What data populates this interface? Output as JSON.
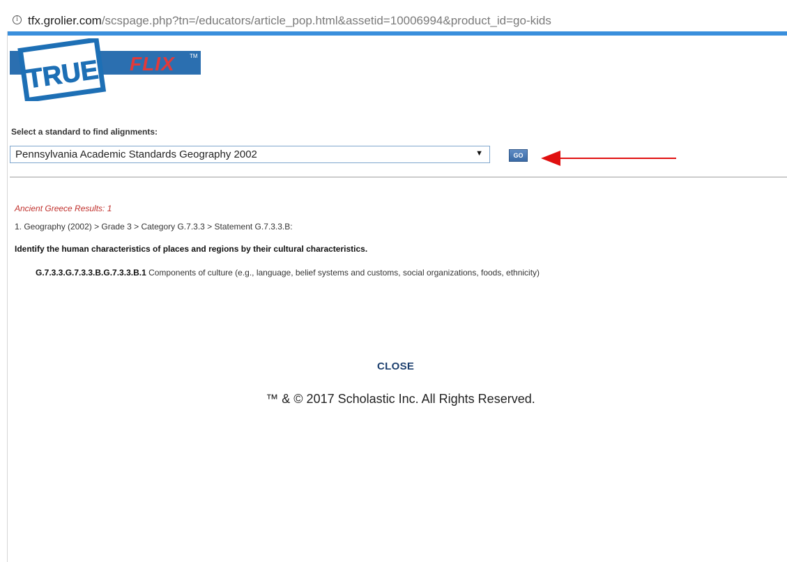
{
  "browser": {
    "url_host": "tfx.grolier.com",
    "url_rest": "/scspage.php?tn=/educators/article_pop.html&assetid=10006994&product_id=go-kids",
    "info_icon": "info-icon"
  },
  "logo": {
    "text_true": "TRUE",
    "text_flix": "FLIX",
    "trademark": "TM"
  },
  "standards": {
    "label": "Select a standard to find alignments:",
    "selected": "Pennsylvania Academic Standards Geography 2002",
    "dropdown_icon": "caret-down-icon",
    "go_label": "GO"
  },
  "annotation": {
    "arrow_color": "#e01010",
    "arrow_icon": "arrow-left-icon"
  },
  "results": {
    "heading": "Ancient Greece Results: 1",
    "breadcrumb": "1. Geography (2002) > Grade 3 > Category G.7.3.3 > Statement G.7.3.3.B:",
    "statement": "Identify the human characteristics of places and regions by their cultural characteristics.",
    "alignment_code": "G.7.3.3.G.7.3.3.B.G.7.3.3.B.1",
    "alignment_text": " Components of culture (e.g., language, belief systems and customs, social organizations, foods, ethnicity)"
  },
  "footer": {
    "close_label": "CLOSE",
    "copyright": "™ & © 2017 Scholastic Inc. All Rights Reserved."
  },
  "colors": {
    "accent_bar": "#3a8fdc",
    "results_heading": "#c0302c",
    "close_link": "#1c3f6e",
    "logo_blue": "#1d6fb5"
  }
}
